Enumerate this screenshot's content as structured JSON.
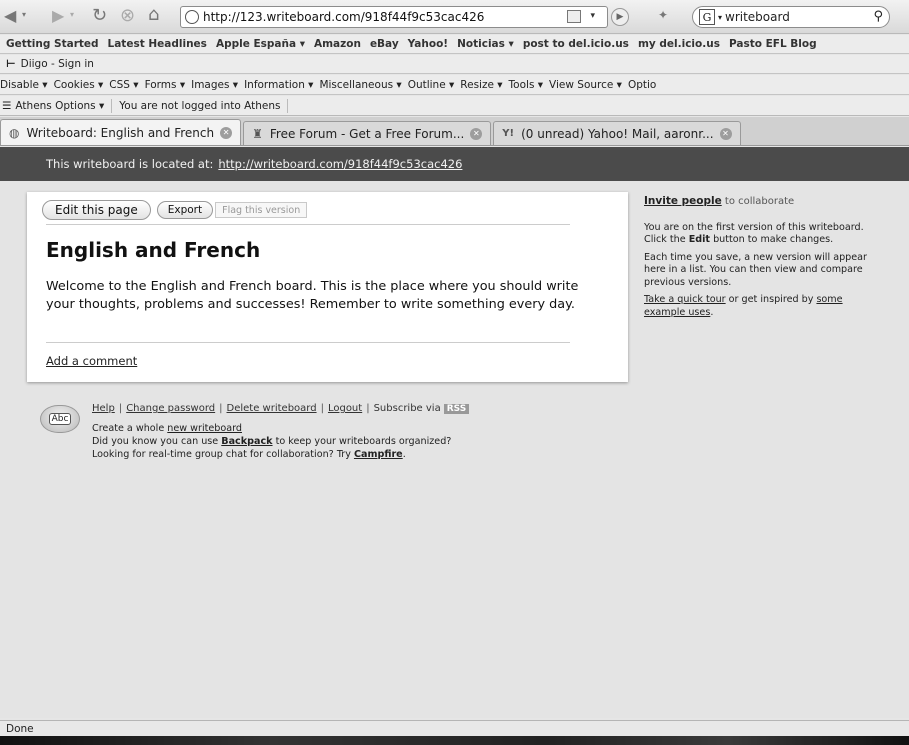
{
  "browser": {
    "url": "http://123.writeboard.com/918f44f9c53cac426",
    "search_engine_label": "G",
    "search_value": "writeboard",
    "status": "Done"
  },
  "bookmarks": [
    "Getting Started",
    "Latest Headlines",
    "Apple España ▾",
    "Amazon",
    "eBay",
    "Yahoo!",
    "Noticias ▾",
    "post to del.icio.us",
    "my del.icio.us",
    "Pasto EFL Blog"
  ],
  "diigo": {
    "label": "Diigo - Sign in"
  },
  "devbar": [
    "Disable ▾",
    "Cookies ▾",
    "CSS ▾",
    "Forms ▾",
    "Images ▾",
    "Information ▾",
    "Miscellaneous ▾",
    "Outline ▾",
    "Resize ▾",
    "Tools ▾",
    "View Source ▾",
    "Optio"
  ],
  "athens": {
    "options": "Athens Options ▾",
    "status": "You are not logged into Athens"
  },
  "tabs": [
    {
      "label": "Writeboard: English and French"
    },
    {
      "label": "Free Forum - Get a Free Forum..."
    },
    {
      "label": "(0 unread) Yahoo! Mail, aaronr..."
    }
  ],
  "page": {
    "location_label": "This writeboard is located at:",
    "location_url": "http://writeboard.com/918f44f9c53cac426",
    "edit_button": "Edit this page",
    "export_button": "Export",
    "flag_button": "Flag this version",
    "title": "English and French",
    "body": "Welcome to the English and French board. This is the place where you should write your thoughts, problems and successes! Remember to write something every day.",
    "add_comment": "Add a comment"
  },
  "sidebar": {
    "invite_link": "Invite people",
    "invite_rest": " to collaborate",
    "version_text_a": "You are on the first version of this writeboard. Click the ",
    "version_bold": "Edit",
    "version_text_b": " button to make changes.",
    "save_text": "Each time you save, a new version will appear here in a list. You can then view and compare previous versions.",
    "tour_link": "Take a quick tour",
    "tour_mid": " or get inspired by ",
    "uses_link": "some example uses",
    "tour_end": "."
  },
  "footer": {
    "logo_text": "Abc",
    "help": "Help",
    "change_password": "Change password",
    "delete_writeboard": "Delete writeboard",
    "logout": "Logout",
    "subscribe": "Subscribe via",
    "rss": "RSS",
    "create_a": "Create a whole ",
    "create_link": "new writeboard",
    "backpack_a": "Did you know you can use ",
    "backpack_link": "Backpack",
    "backpack_b": " to keep your writeboards organized?",
    "campfire_a": "Looking for real-time group chat for collaboration? Try ",
    "campfire_link": "Campfire",
    "campfire_b": "."
  }
}
